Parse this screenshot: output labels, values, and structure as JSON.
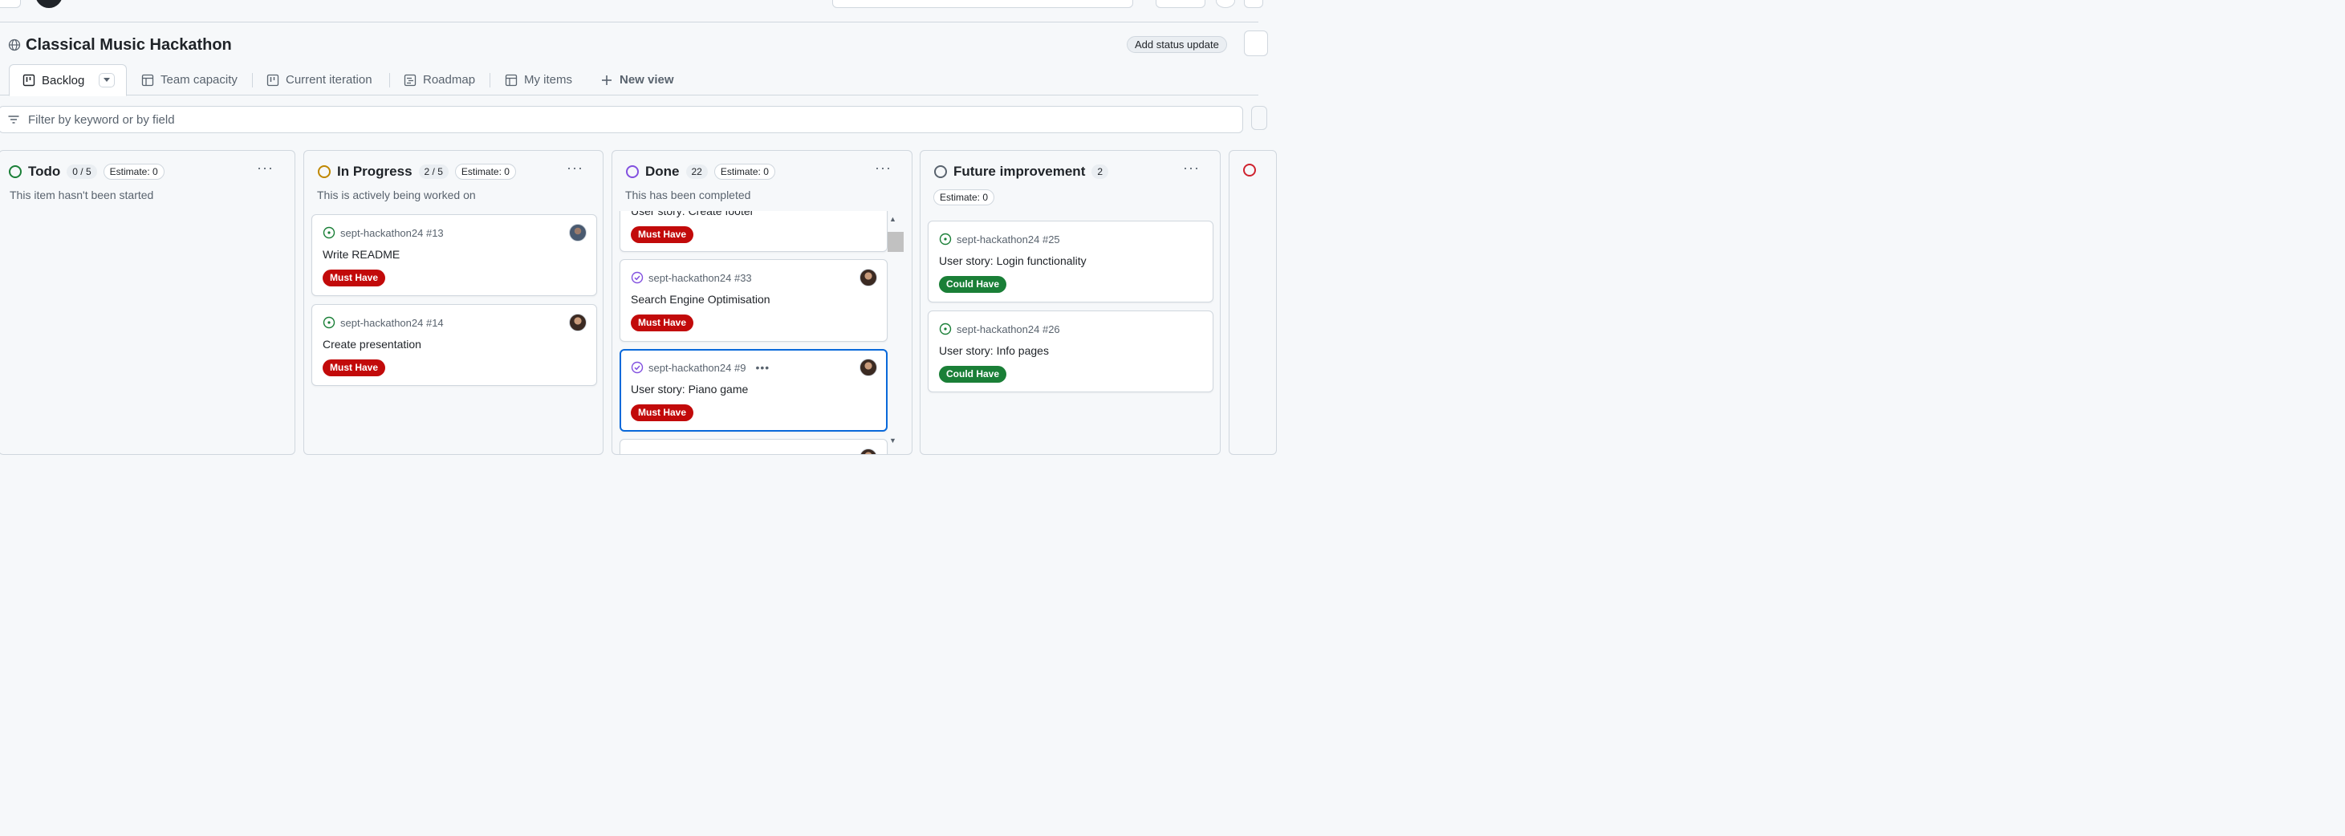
{
  "project": {
    "title": "Classical Music Hackathon",
    "status_button": "Add status update"
  },
  "tabs": [
    {
      "label": "Backlog"
    },
    {
      "label": "Team capacity"
    },
    {
      "label": "Current iteration"
    },
    {
      "label": "Roadmap"
    },
    {
      "label": "My items"
    },
    {
      "label": "New view"
    }
  ],
  "filter": {
    "placeholder": "Filter by keyword or by field"
  },
  "colors": {
    "todo": "#1a7f37",
    "in_progress": "#bf8700",
    "done": "#8250df",
    "future": "#59636e",
    "must_have": "#c20a0a",
    "could_have": "#1a7f37",
    "selected": "#0969da"
  },
  "columns": [
    {
      "title": "Todo",
      "count": "0 / 5",
      "estimate": "Estimate: 0",
      "description": "This item hasn't been started",
      "cards": []
    },
    {
      "title": "In Progress",
      "count": "2 / 5",
      "estimate": "Estimate: 0",
      "description": "This is actively being worked on",
      "cards": [
        {
          "ref": "sept-hackathon24 #13",
          "title": "Write README",
          "label": "Must Have"
        },
        {
          "ref": "sept-hackathon24 #14",
          "title": "Create presentation",
          "label": "Must Have"
        }
      ]
    },
    {
      "title": "Done",
      "count": "22",
      "estimate": "Estimate: 0",
      "description": "This has been completed",
      "cards": [
        {
          "ref": "",
          "title": "User story: Create footer",
          "label": "Must Have"
        },
        {
          "ref": "sept-hackathon24 #33",
          "title": "Search Engine Optimisation",
          "label": "Must Have"
        },
        {
          "ref": "sept-hackathon24 #9",
          "title": "User story: Piano game",
          "label": "Must Have"
        }
      ]
    },
    {
      "title": "Future improvement",
      "count": "2",
      "estimate": "Estimate: 0",
      "description": "",
      "cards": [
        {
          "ref": "sept-hackathon24 #25",
          "title": "User story: Login functionality",
          "label": "Could Have"
        },
        {
          "ref": "sept-hackathon24 #26",
          "title": "User story: Info pages",
          "label": "Could Have"
        }
      ]
    }
  ]
}
